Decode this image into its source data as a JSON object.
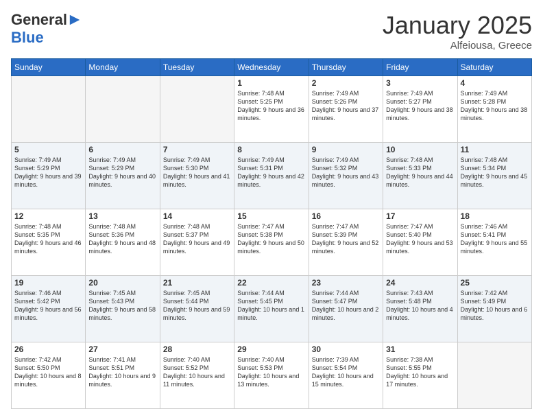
{
  "header": {
    "logo_general": "General",
    "logo_blue": "Blue",
    "month_title": "January 2025",
    "location": "Alfeiousa, Greece"
  },
  "weekdays": [
    "Sunday",
    "Monday",
    "Tuesday",
    "Wednesday",
    "Thursday",
    "Friday",
    "Saturday"
  ],
  "weeks": [
    [
      {
        "day": "",
        "info": ""
      },
      {
        "day": "",
        "info": ""
      },
      {
        "day": "",
        "info": ""
      },
      {
        "day": "1",
        "info": "Sunrise: 7:48 AM\nSunset: 5:25 PM\nDaylight: 9 hours and 36 minutes."
      },
      {
        "day": "2",
        "info": "Sunrise: 7:49 AM\nSunset: 5:26 PM\nDaylight: 9 hours and 37 minutes."
      },
      {
        "day": "3",
        "info": "Sunrise: 7:49 AM\nSunset: 5:27 PM\nDaylight: 9 hours and 38 minutes."
      },
      {
        "day": "4",
        "info": "Sunrise: 7:49 AM\nSunset: 5:28 PM\nDaylight: 9 hours and 38 minutes."
      }
    ],
    [
      {
        "day": "5",
        "info": "Sunrise: 7:49 AM\nSunset: 5:29 PM\nDaylight: 9 hours and 39 minutes."
      },
      {
        "day": "6",
        "info": "Sunrise: 7:49 AM\nSunset: 5:29 PM\nDaylight: 9 hours and 40 minutes."
      },
      {
        "day": "7",
        "info": "Sunrise: 7:49 AM\nSunset: 5:30 PM\nDaylight: 9 hours and 41 minutes."
      },
      {
        "day": "8",
        "info": "Sunrise: 7:49 AM\nSunset: 5:31 PM\nDaylight: 9 hours and 42 minutes."
      },
      {
        "day": "9",
        "info": "Sunrise: 7:49 AM\nSunset: 5:32 PM\nDaylight: 9 hours and 43 minutes."
      },
      {
        "day": "10",
        "info": "Sunrise: 7:48 AM\nSunset: 5:33 PM\nDaylight: 9 hours and 44 minutes."
      },
      {
        "day": "11",
        "info": "Sunrise: 7:48 AM\nSunset: 5:34 PM\nDaylight: 9 hours and 45 minutes."
      }
    ],
    [
      {
        "day": "12",
        "info": "Sunrise: 7:48 AM\nSunset: 5:35 PM\nDaylight: 9 hours and 46 minutes."
      },
      {
        "day": "13",
        "info": "Sunrise: 7:48 AM\nSunset: 5:36 PM\nDaylight: 9 hours and 48 minutes."
      },
      {
        "day": "14",
        "info": "Sunrise: 7:48 AM\nSunset: 5:37 PM\nDaylight: 9 hours and 49 minutes."
      },
      {
        "day": "15",
        "info": "Sunrise: 7:47 AM\nSunset: 5:38 PM\nDaylight: 9 hours and 50 minutes."
      },
      {
        "day": "16",
        "info": "Sunrise: 7:47 AM\nSunset: 5:39 PM\nDaylight: 9 hours and 52 minutes."
      },
      {
        "day": "17",
        "info": "Sunrise: 7:47 AM\nSunset: 5:40 PM\nDaylight: 9 hours and 53 minutes."
      },
      {
        "day": "18",
        "info": "Sunrise: 7:46 AM\nSunset: 5:41 PM\nDaylight: 9 hours and 55 minutes."
      }
    ],
    [
      {
        "day": "19",
        "info": "Sunrise: 7:46 AM\nSunset: 5:42 PM\nDaylight: 9 hours and 56 minutes."
      },
      {
        "day": "20",
        "info": "Sunrise: 7:45 AM\nSunset: 5:43 PM\nDaylight: 9 hours and 58 minutes."
      },
      {
        "day": "21",
        "info": "Sunrise: 7:45 AM\nSunset: 5:44 PM\nDaylight: 9 hours and 59 minutes."
      },
      {
        "day": "22",
        "info": "Sunrise: 7:44 AM\nSunset: 5:45 PM\nDaylight: 10 hours and 1 minute."
      },
      {
        "day": "23",
        "info": "Sunrise: 7:44 AM\nSunset: 5:47 PM\nDaylight: 10 hours and 2 minutes."
      },
      {
        "day": "24",
        "info": "Sunrise: 7:43 AM\nSunset: 5:48 PM\nDaylight: 10 hours and 4 minutes."
      },
      {
        "day": "25",
        "info": "Sunrise: 7:42 AM\nSunset: 5:49 PM\nDaylight: 10 hours and 6 minutes."
      }
    ],
    [
      {
        "day": "26",
        "info": "Sunrise: 7:42 AM\nSunset: 5:50 PM\nDaylight: 10 hours and 8 minutes."
      },
      {
        "day": "27",
        "info": "Sunrise: 7:41 AM\nSunset: 5:51 PM\nDaylight: 10 hours and 9 minutes."
      },
      {
        "day": "28",
        "info": "Sunrise: 7:40 AM\nSunset: 5:52 PM\nDaylight: 10 hours and 11 minutes."
      },
      {
        "day": "29",
        "info": "Sunrise: 7:40 AM\nSunset: 5:53 PM\nDaylight: 10 hours and 13 minutes."
      },
      {
        "day": "30",
        "info": "Sunrise: 7:39 AM\nSunset: 5:54 PM\nDaylight: 10 hours and 15 minutes."
      },
      {
        "day": "31",
        "info": "Sunrise: 7:38 AM\nSunset: 5:55 PM\nDaylight: 10 hours and 17 minutes."
      },
      {
        "day": "",
        "info": ""
      }
    ]
  ]
}
